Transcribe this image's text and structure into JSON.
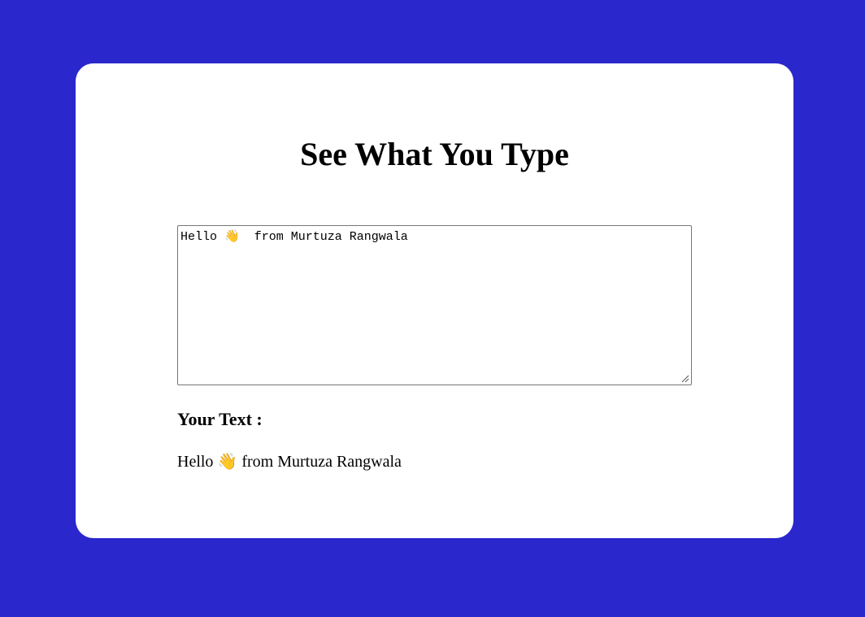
{
  "app": {
    "title": "See What You Type"
  },
  "input": {
    "value": "Hello 👋  from Murtuza Rangwala",
    "placeholder": ""
  },
  "output": {
    "label": "Your Text :",
    "text": "Hello 👋 from Murtuza Rangwala"
  },
  "colors": {
    "background": "#2a27cc",
    "card": "#ffffff",
    "border": "#767676"
  },
  "icons": {
    "resize": "resize-grip-icon"
  }
}
